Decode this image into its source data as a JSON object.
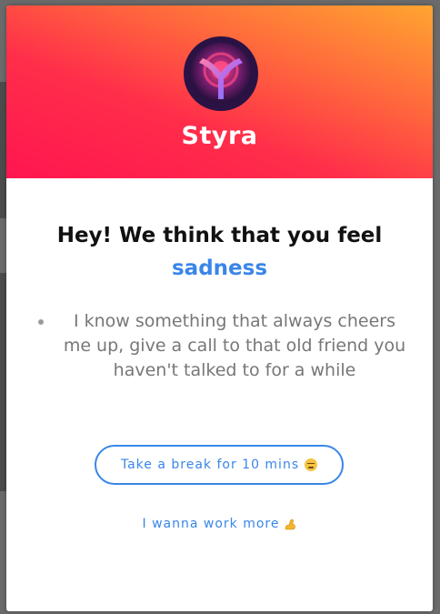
{
  "popup": {
    "brand_name": "Styra",
    "headline": "Hey! We think that you feel",
    "emotion": "sadness",
    "suggestions": [
      "I know something that always cheers me up, give a call to that old friend you haven't talked to for a while"
    ],
    "break_button_label": "Take a break for 10 mins",
    "break_button_icon": "sad-face-icon",
    "work_more_label": "I wanna work more",
    "work_more_icon": "flexed-biceps-icon"
  },
  "colors": {
    "header_gradient": [
      "#ffa530",
      "#ff6a3c",
      "#ff2e4a",
      "#ff1550"
    ],
    "accent": "#3a86e8",
    "headline": "#111111",
    "body_text": "#777777"
  }
}
